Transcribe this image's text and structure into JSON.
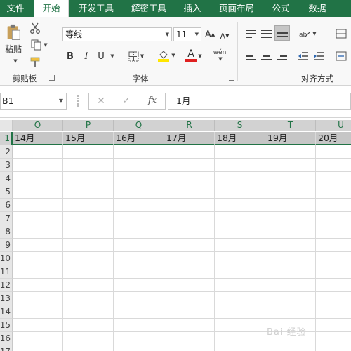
{
  "tabs": [
    {
      "label": "文件",
      "active": false
    },
    {
      "label": "开始",
      "active": true
    },
    {
      "label": "开发工具",
      "active": false
    },
    {
      "label": "解密工具",
      "active": false
    },
    {
      "label": "插入",
      "active": false
    },
    {
      "label": "页面布局",
      "active": false
    },
    {
      "label": "公式",
      "active": false
    },
    {
      "label": "数据",
      "active": false
    }
  ],
  "ribbon": {
    "clipboard": {
      "label": "剪贴板",
      "paste_label": "粘贴"
    },
    "font": {
      "label": "字体",
      "font_name": "等线",
      "font_size": "11",
      "bold": "B",
      "italic": "I",
      "underline": "U",
      "grow": "A",
      "shrink": "A",
      "font_color_glyph": "A",
      "phonetic": "wén"
    },
    "alignment": {
      "label": "对齐方式"
    }
  },
  "formula_bar": {
    "name_box": "B1",
    "cancel": "✕",
    "enter": "✓",
    "fx": "fx",
    "content": "1月"
  },
  "grid": {
    "columns": [
      "O",
      "P",
      "Q",
      "R",
      "S",
      "T",
      "U"
    ],
    "row_numbers": [
      "1",
      "2",
      "3",
      "4",
      "5",
      "6",
      "7",
      "8",
      "9",
      "10",
      "11",
      "12",
      "13",
      "14",
      "15",
      "16",
      "17"
    ],
    "row1_values": [
      "14月",
      "15月",
      "16月",
      "17月",
      "18月",
      "19月",
      "20月"
    ]
  },
  "watermark": "Bai 经验",
  "colors": {
    "accent": "#217346",
    "selected_fill": "#c6c6c6",
    "fill_color_bar": "#ffe600",
    "font_color_bar": "#e02020"
  }
}
